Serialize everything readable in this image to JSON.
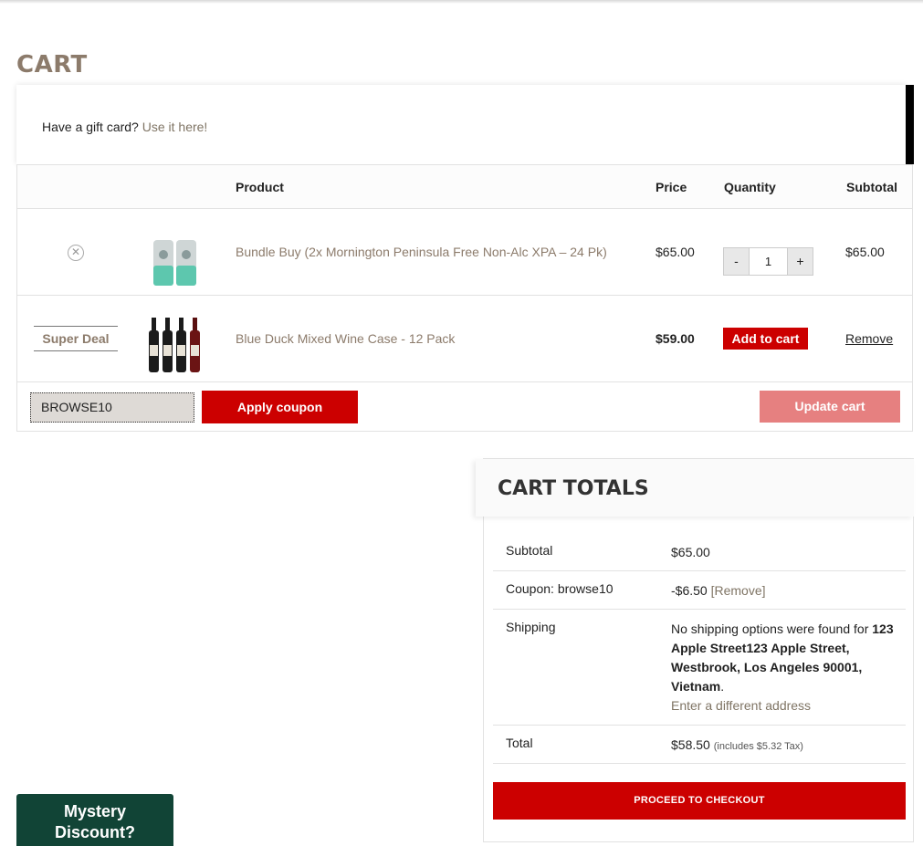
{
  "page": {
    "title": "CART"
  },
  "gift_card": {
    "prompt": "Have a gift card?",
    "link": "Use it here!"
  },
  "table": {
    "headers": {
      "product": "Product",
      "price": "Price",
      "quantity": "Quantity",
      "subtotal": "Subtotal"
    },
    "rows": [
      {
        "name": "Bundle Buy (2x Mornington Peninsula Free Non-Alc XPA – 24 Pk)",
        "price": "$65.00",
        "quantity": "1",
        "qty_minus": "-",
        "qty_plus": "+",
        "subtotal": "$65.00",
        "remove_icon": "✕"
      },
      {
        "badge": "Super Deal",
        "name": "Blue Duck Mixed Wine Case - 12 Pack",
        "price": "$59.00",
        "add_label": "Add to cart",
        "remove_label": "Remove"
      }
    ]
  },
  "coupon": {
    "value": "BROWSE10",
    "apply_label": "Apply coupon",
    "update_label": "Update cart"
  },
  "totals": {
    "title": "CART TOTALS",
    "subtotal_label": "Subtotal",
    "subtotal_value": "$65.00",
    "coupon_label": "Coupon: browse10",
    "coupon_value": "-$6.50",
    "coupon_remove": "[Remove]",
    "shipping_label": "Shipping",
    "shipping_text": "No shipping options were found for",
    "shipping_address": "123 Apple Street123 Apple Street, Westbrook, Los Angeles 90001, Vietnam",
    "shipping_period": ".",
    "shipping_link": "Enter a different address",
    "total_label": "Total",
    "total_value": "$58.50",
    "total_tax": "(includes $5.32 Tax)",
    "checkout_label": "PROCEED TO CHECKOUT"
  },
  "popup": {
    "line1": "Mystery",
    "line2": "Discount?"
  },
  "colors": {
    "accent": "#cc0000",
    "muted_text": "#7f7464",
    "popup_bg": "#114436"
  }
}
